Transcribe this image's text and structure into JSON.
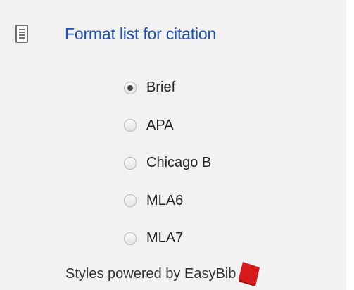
{
  "header": {
    "icon": "document-icon",
    "link_label": "Format list for citation"
  },
  "citation_styles": {
    "selected": "Brief",
    "options": [
      {
        "label": "Brief",
        "checked": true
      },
      {
        "label": "APA",
        "checked": false
      },
      {
        "label": "Chicago B",
        "checked": false
      },
      {
        "label": "MLA6",
        "checked": false
      },
      {
        "label": "MLA7",
        "checked": false
      }
    ]
  },
  "footer": {
    "text": "Styles powered by EasyBib",
    "logo_icon": "easybib-logo",
    "logo_color": "#d7191c"
  },
  "colors": {
    "panel_background": "#f2f2f2",
    "link": "#1f4fb3"
  }
}
